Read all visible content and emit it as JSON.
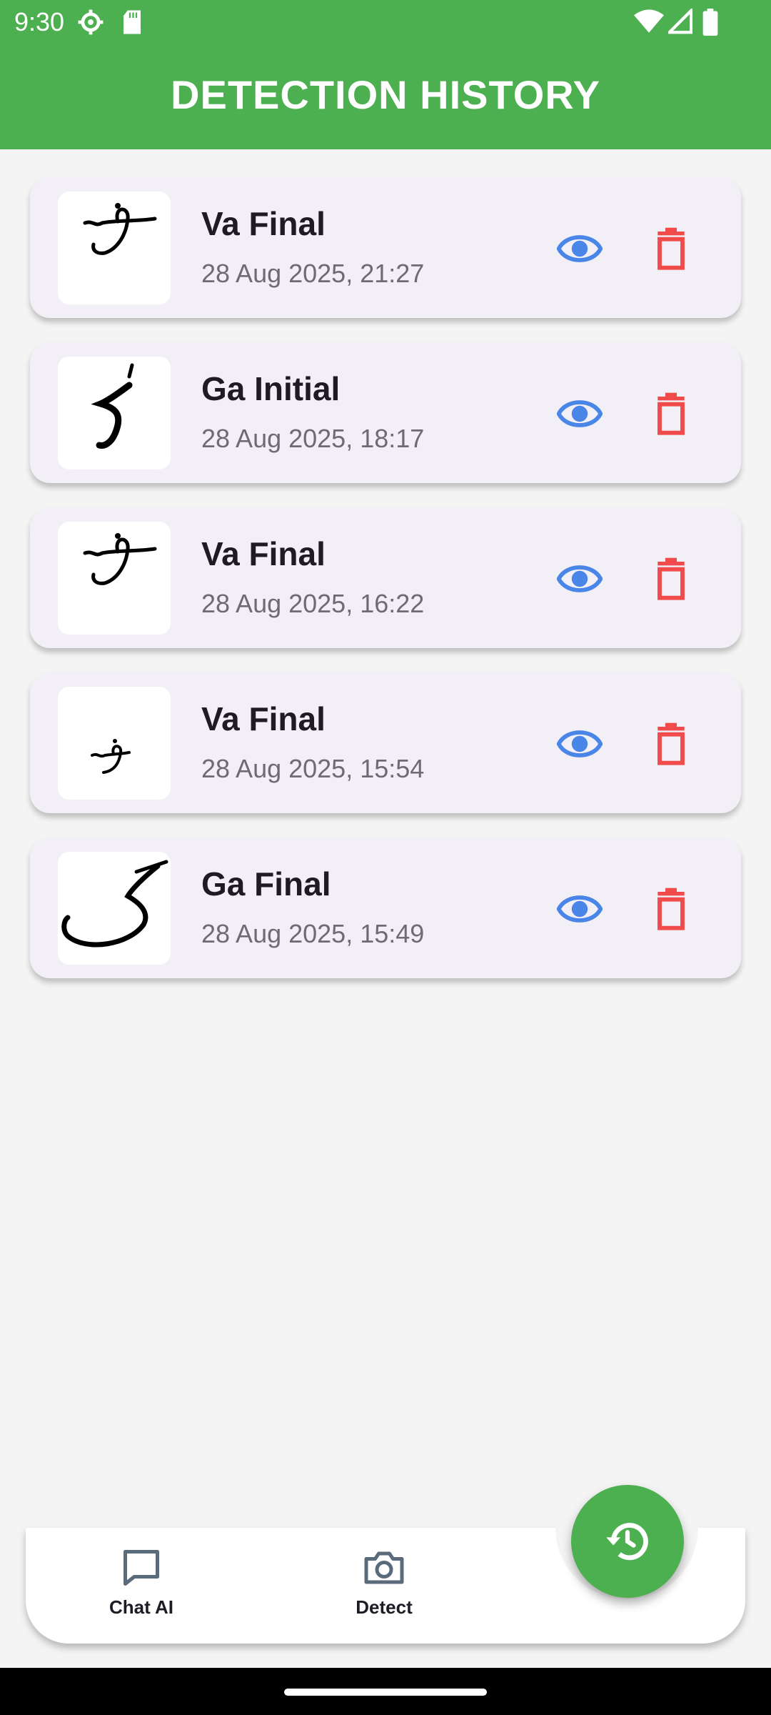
{
  "status_bar": {
    "time": "9:30"
  },
  "app_bar": {
    "title": "DETECTION HISTORY"
  },
  "history": [
    {
      "title": "Va Final",
      "date": "28 Aug 2025, 21:27"
    },
    {
      "title": "Ga Initial",
      "date": "28 Aug 2025, 18:17"
    },
    {
      "title": "Va Final",
      "date": "28 Aug 2025, 16:22"
    },
    {
      "title": "Va Final",
      "date": "28 Aug 2025, 15:54"
    },
    {
      "title": "Ga Final",
      "date": "28 Aug 2025, 15:49"
    }
  ],
  "bottom_nav": {
    "chat_label": "Chat AI",
    "detect_label": "Detect"
  },
  "colors": {
    "accent": "#4caf50",
    "view_icon": "#4a86e8",
    "delete_icon": "#f04a4a"
  },
  "icons": {
    "view": "eye-icon",
    "delete": "trash-icon",
    "chat": "chat-icon",
    "detect": "camera-icon",
    "fab": "history-icon"
  }
}
